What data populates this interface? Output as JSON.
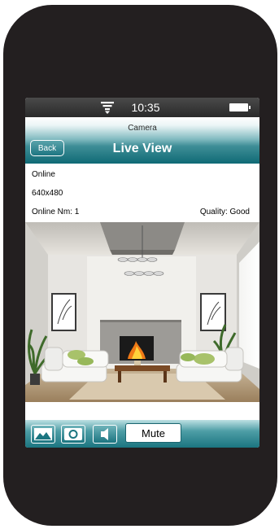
{
  "status_bar": {
    "time": "10:35"
  },
  "nav": {
    "subtitle": "Camera",
    "title": "Live View",
    "back_label": "Back"
  },
  "info": {
    "status": "Online",
    "resolution": "640x480",
    "online_num": "Online Nm: 1",
    "quality": "Quality: Good"
  },
  "toolbar": {
    "mute_label": "Mute"
  },
  "icons": {
    "wifi": "wifi-icon",
    "battery": "battery-icon",
    "gallery": "gallery-icon",
    "snapshot": "snapshot-icon",
    "speaker": "speaker-icon"
  },
  "colors": {
    "accent": "#1b7580",
    "phone_body": "#231f20"
  }
}
